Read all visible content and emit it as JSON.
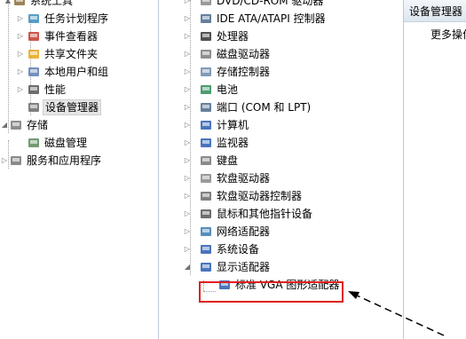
{
  "left_tree": [
    {
      "label": "系统工具",
      "icon": "system-tools-icon",
      "expanded": true
    },
    {
      "label": "任务计划程序",
      "icon": "clock-icon"
    },
    {
      "label": "事件查看器",
      "icon": "event-viewer-icon"
    },
    {
      "label": "共享文件夹",
      "icon": "shared-folder-icon"
    },
    {
      "label": "本地用户和组",
      "icon": "users-icon"
    },
    {
      "label": "性能",
      "icon": "performance-icon"
    },
    {
      "label": "设备管理器",
      "icon": "device-manager-icon",
      "selected": true
    },
    {
      "label": "存储",
      "icon": "storage-icon",
      "expanded": true
    },
    {
      "label": "磁盘管理",
      "icon": "disk-management-icon"
    },
    {
      "label": "服务和应用程序",
      "icon": "services-icon"
    }
  ],
  "device_tree": [
    {
      "label": "DVD/CD-ROM 驱动器",
      "icon": "dvd-icon"
    },
    {
      "label": "IDE ATA/ATAPI 控制器",
      "icon": "ide-icon"
    },
    {
      "label": "处理器",
      "icon": "processor-icon"
    },
    {
      "label": "磁盘驱动器",
      "icon": "disk-drive-icon"
    },
    {
      "label": "存储控制器",
      "icon": "storage-controller-icon"
    },
    {
      "label": "电池",
      "icon": "battery-icon"
    },
    {
      "label": "端口 (COM 和 LPT)",
      "icon": "port-icon"
    },
    {
      "label": "计算机",
      "icon": "computer-icon"
    },
    {
      "label": "监视器",
      "icon": "monitor-icon"
    },
    {
      "label": "键盘",
      "icon": "keyboard-icon"
    },
    {
      "label": "软盘驱动器",
      "icon": "floppy-drive-icon"
    },
    {
      "label": "软盘驱动器控制器",
      "icon": "floppy-controller-icon"
    },
    {
      "label": "鼠标和其他指针设备",
      "icon": "mouse-icon"
    },
    {
      "label": "网络适配器",
      "icon": "network-adapter-icon"
    },
    {
      "label": "系统设备",
      "icon": "system-device-icon"
    },
    {
      "label": "显示适配器",
      "icon": "display-adapter-icon",
      "expanded": true
    },
    {
      "label": "标准 VGA 图形适配器",
      "icon": "vga-adapter-icon",
      "child": true,
      "highlighted": true
    }
  ],
  "actions": {
    "header": "设备管理器",
    "more": "更多操作"
  },
  "colors": {
    "highlight_box": "#e02020",
    "selection_bg": "#e6e6e6",
    "header_bg": "#dde6f0"
  }
}
